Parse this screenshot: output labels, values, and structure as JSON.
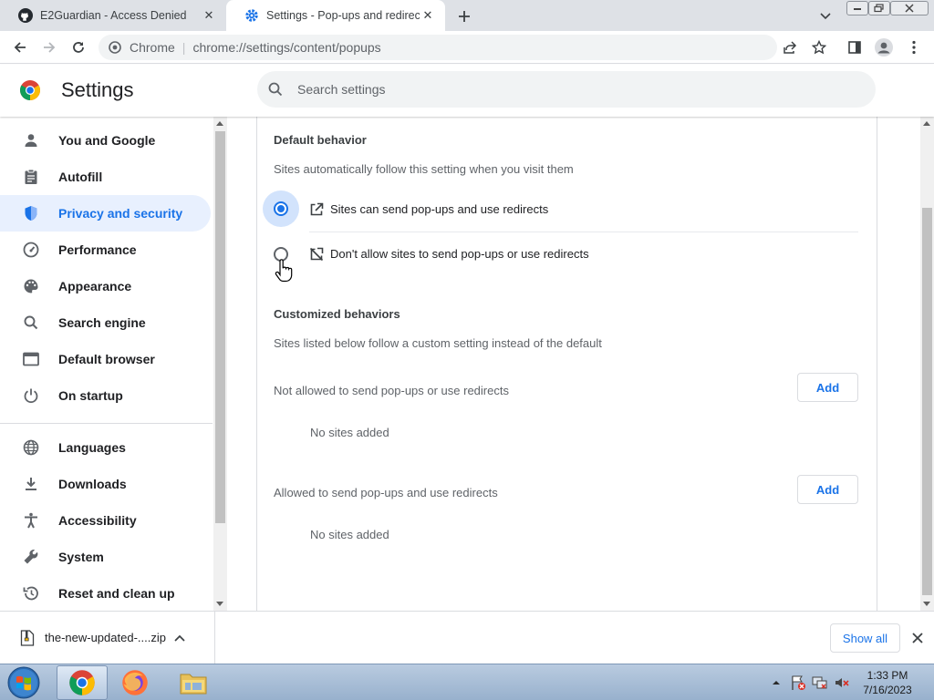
{
  "tabs": [
    {
      "title": "E2Guardian - Access Denied",
      "icon": "github-icon",
      "active": false
    },
    {
      "title": "Settings - Pop-ups and redirects",
      "icon": "settings-gear-icon",
      "active": true
    }
  ],
  "omnibox": {
    "chip": "Chrome",
    "separator": "|",
    "url": "chrome://settings/content/popups"
  },
  "header": {
    "title": "Settings",
    "search_placeholder": "Search settings"
  },
  "sidebar": {
    "items": [
      {
        "label": "You and Google",
        "icon": "person-icon"
      },
      {
        "label": "Autofill",
        "icon": "clipboard-icon"
      },
      {
        "label": "Privacy and security",
        "icon": "shield-icon",
        "active": true
      },
      {
        "label": "Performance",
        "icon": "speedometer-icon"
      },
      {
        "label": "Appearance",
        "icon": "palette-icon"
      },
      {
        "label": "Search engine",
        "icon": "search-icon"
      },
      {
        "label": "Default browser",
        "icon": "browser-window-icon"
      },
      {
        "label": "On startup",
        "icon": "power-icon"
      },
      {
        "label": "Languages",
        "icon": "globe-icon"
      },
      {
        "label": "Downloads",
        "icon": "download-icon"
      },
      {
        "label": "Accessibility",
        "icon": "accessibility-icon"
      },
      {
        "label": "System",
        "icon": "wrench-icon"
      },
      {
        "label": "Reset and clean up",
        "icon": "history-reset-icon"
      }
    ]
  },
  "content": {
    "default_heading": "Default behavior",
    "default_desc": "Sites automatically follow this setting when you visit them",
    "option_allow": "Sites can send pop-ups and use redirects",
    "option_block": "Don't allow sites to send pop-ups or use redirects",
    "selected_option": "allow",
    "custom_heading": "Customized behaviors",
    "custom_desc": "Sites listed below follow a custom setting instead of the default",
    "not_allowed_label": "Not allowed to send pop-ups or use redirects",
    "not_allowed_empty": "No sites added",
    "allowed_label": "Allowed to send pop-ups and use redirects",
    "allowed_empty": "No sites added",
    "add_label": "Add"
  },
  "downloads": {
    "file_name": "the-new-updated-....zip",
    "show_all": "Show all"
  },
  "taskbar": {
    "time": "1:33 PM",
    "date": "7/16/2023"
  },
  "colors": {
    "accent": "#1a73e8",
    "active_nav_bg": "#e8f0fe"
  }
}
